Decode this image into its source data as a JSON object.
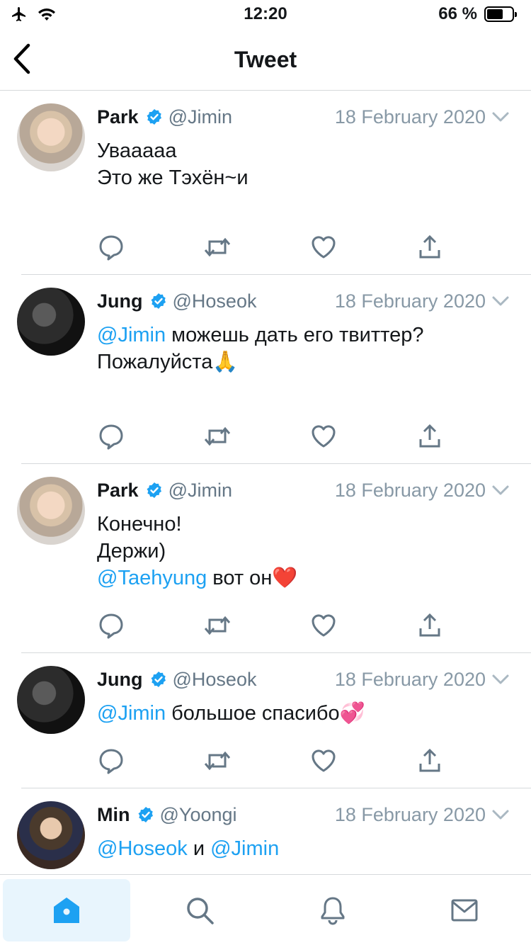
{
  "status": {
    "time": "12:20",
    "battery": "66 %",
    "battery_level": 0.66
  },
  "nav": {
    "title": "Tweet"
  },
  "colors": {
    "accent": "#1da1f2",
    "muted": "#657786",
    "divider": "#d6d9db"
  },
  "tweets": [
    {
      "name": "Park",
      "handle": "@Jimin",
      "date": "18 February 2020",
      "lines": [
        [
          {
            "t": "Увааааа"
          }
        ],
        [
          {
            "t": "Это же Тэхён~и"
          }
        ]
      ]
    },
    {
      "name": "Jung",
      "handle": "@Hoseok",
      "date": "18 February 2020",
      "lines": [
        [
          {
            "t": "@Jimin",
            "m": true
          },
          {
            "t": " можешь дать его твиттер?"
          }
        ],
        [
          {
            "t": "Пожалуйста🙏"
          }
        ]
      ]
    },
    {
      "name": "Park",
      "handle": "@Jimin",
      "date": "18 February 2020",
      "lines": [
        [
          {
            "t": "Конечно!"
          }
        ],
        [
          {
            "t": "Держи)"
          }
        ],
        [
          {
            "t": "@Taehyung",
            "m": true
          },
          {
            "t": " вот он❤️"
          }
        ]
      ]
    },
    {
      "name": "Jung",
      "handle": "@Hoseok",
      "date": "18 February 2020",
      "lines": [
        [
          {
            "t": "@Jimin",
            "m": true
          },
          {
            "t": " большое спасибо💞"
          }
        ]
      ]
    },
    {
      "name": "Min",
      "handle": "@Yoongi",
      "date": "18 February 2020",
      "lines": [
        [
          {
            "t": "@Hoseok",
            "m": true
          },
          {
            "t": " и "
          },
          {
            "t": "@Jimin",
            "m": true
          }
        ]
      ]
    }
  ],
  "tabs": [
    {
      "icon": "home-icon",
      "active": true
    },
    {
      "icon": "search-icon",
      "active": false
    },
    {
      "icon": "bell-icon",
      "active": false
    },
    {
      "icon": "mail-icon",
      "active": false
    }
  ]
}
